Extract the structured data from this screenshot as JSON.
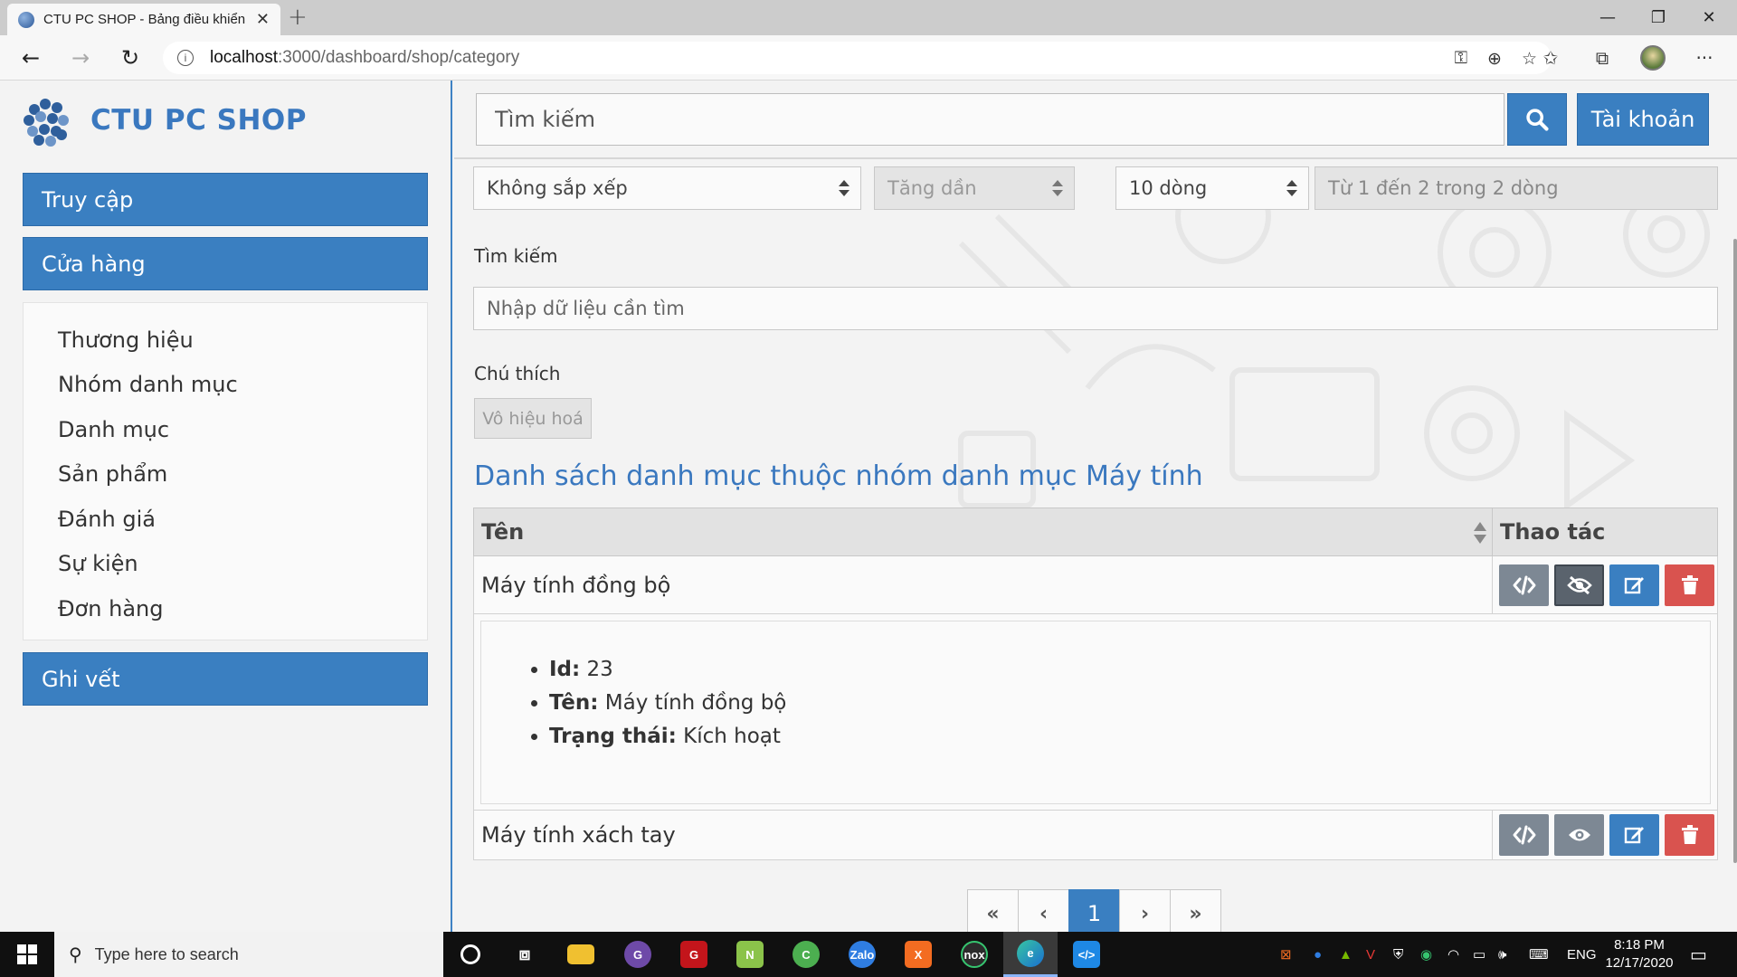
{
  "browser": {
    "tab_title": "CTU PC SHOP - Bảng điều khiển",
    "url_host": "localhost",
    "url_path": ":3000/dashboard/shop/category"
  },
  "sidebar": {
    "brand": "CTU PC SHOP",
    "menu": [
      {
        "label": "Truy cập"
      },
      {
        "label": "Cửa hàng"
      },
      {
        "label": "Ghi vết"
      }
    ],
    "submenu": [
      {
        "label": "Thương hiệu"
      },
      {
        "label": "Nhóm danh mục"
      },
      {
        "label": "Danh mục"
      },
      {
        "label": "Sản phẩm"
      },
      {
        "label": "Đánh giá"
      },
      {
        "label": "Sự kiện"
      },
      {
        "label": "Đơn hàng"
      }
    ]
  },
  "header": {
    "search_placeholder": "Tìm kiếm",
    "account_label": "Tài khoản"
  },
  "filters": {
    "sort_select": "Không sắp xếp",
    "order_select": "Tăng dần",
    "rows_select": "10 dòng",
    "row_info": "Từ 1 đến 2 trong 2 dòng",
    "search_label": "Tìm kiếm",
    "search_placeholder": "Nhập dữ liệu cần tìm",
    "note_label": "Chú thích",
    "note_button": "Vô hiệu hoá"
  },
  "table": {
    "heading": "Danh sách danh mục thuộc nhóm danh mục Máy tính",
    "col_name": "Tên",
    "col_actions": "Thao tác",
    "rows": [
      {
        "name": "Máy tính đồng bộ",
        "expanded": true,
        "visibility_icon": "eye-slash-icon"
      },
      {
        "name": "Máy tính xách tay",
        "expanded": false,
        "visibility_icon": "eye-icon"
      }
    ],
    "detail": {
      "id_label": "Id:",
      "id_value": "23",
      "name_label": "Tên:",
      "name_value": "Máy tính đồng bộ",
      "status_label": "Trạng thái:",
      "status_value": "Kích hoạt"
    }
  },
  "pagination": {
    "first": "«",
    "prev": "‹",
    "current": "1",
    "next": "›",
    "last": "»"
  },
  "taskbar": {
    "search_placeholder": "Type here to search",
    "language": "ENG",
    "time": "8:18 PM",
    "date": "12/17/2020"
  },
  "colors": {
    "primary": "#3a7fc1",
    "danger": "#d9534f",
    "secondary": "#7d8894",
    "brand_text": "#3a78bf"
  }
}
